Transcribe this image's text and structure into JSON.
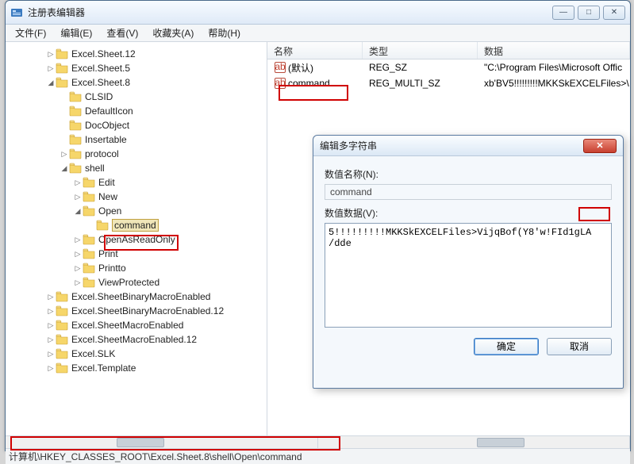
{
  "window": {
    "title": "注册表编辑器",
    "buttons": {
      "min": "—",
      "max": "□",
      "close": "✕"
    }
  },
  "menu": [
    "文件(F)",
    "编辑(E)",
    "查看(V)",
    "收藏夹(A)",
    "帮助(H)"
  ],
  "tree": [
    {
      "indent": 3,
      "label": "Excel.Sheet.12",
      "expander": "▷"
    },
    {
      "indent": 3,
      "label": "Excel.Sheet.5",
      "expander": "▷"
    },
    {
      "indent": 3,
      "label": "Excel.Sheet.8",
      "expander": "◢"
    },
    {
      "indent": 4,
      "label": "CLSID",
      "expander": ""
    },
    {
      "indent": 4,
      "label": "DefaultIcon",
      "expander": ""
    },
    {
      "indent": 4,
      "label": "DocObject",
      "expander": ""
    },
    {
      "indent": 4,
      "label": "Insertable",
      "expander": ""
    },
    {
      "indent": 4,
      "label": "protocol",
      "expander": "▷"
    },
    {
      "indent": 4,
      "label": "shell",
      "expander": "◢"
    },
    {
      "indent": 5,
      "label": "Edit",
      "expander": "▷"
    },
    {
      "indent": 5,
      "label": "New",
      "expander": "▷"
    },
    {
      "indent": 5,
      "label": "Open",
      "expander": "◢"
    },
    {
      "indent": 6,
      "label": "command",
      "expander": "",
      "selected": true
    },
    {
      "indent": 5,
      "label": "OpenAsReadOnly",
      "expander": "▷"
    },
    {
      "indent": 5,
      "label": "Print",
      "expander": "▷"
    },
    {
      "indent": 5,
      "label": "Printto",
      "expander": "▷"
    },
    {
      "indent": 5,
      "label": "ViewProtected",
      "expander": "▷"
    },
    {
      "indent": 3,
      "label": "Excel.SheetBinaryMacroEnabled",
      "expander": "▷"
    },
    {
      "indent": 3,
      "label": "Excel.SheetBinaryMacroEnabled.12",
      "expander": "▷"
    },
    {
      "indent": 3,
      "label": "Excel.SheetMacroEnabled",
      "expander": "▷"
    },
    {
      "indent": 3,
      "label": "Excel.SheetMacroEnabled.12",
      "expander": "▷"
    },
    {
      "indent": 3,
      "label": "Excel.SLK",
      "expander": "▷"
    },
    {
      "indent": 3,
      "label": "Excel.Template",
      "expander": "▷"
    }
  ],
  "list": {
    "columns": {
      "name": "名称",
      "type": "类型",
      "data": "数据"
    },
    "rows": [
      {
        "name": "(默认)",
        "type": "REG_SZ",
        "data": "\"C:\\Program Files\\Microsoft Offic"
      },
      {
        "name": "command",
        "type": "REG_MULTI_SZ",
        "data": "xb'BV5!!!!!!!!!MKKSkEXCELFiles>\\",
        "highlight": true
      }
    ]
  },
  "dialog": {
    "title": "编辑多字符串",
    "name_label": "数值名称(N):",
    "name_value": "command",
    "data_label": "数值数据(V):",
    "data_value": "5!!!!!!!!!MKKSkEXCELFiles>VijqBof(Y8'w!FId1gLA /dde",
    "ok": "确定",
    "cancel": "取消"
  },
  "statusbar": "计算机\\HKEY_CLASSES_ROOT\\Excel.Sheet.8\\shell\\Open\\command",
  "highlight_snippet": "/dde"
}
